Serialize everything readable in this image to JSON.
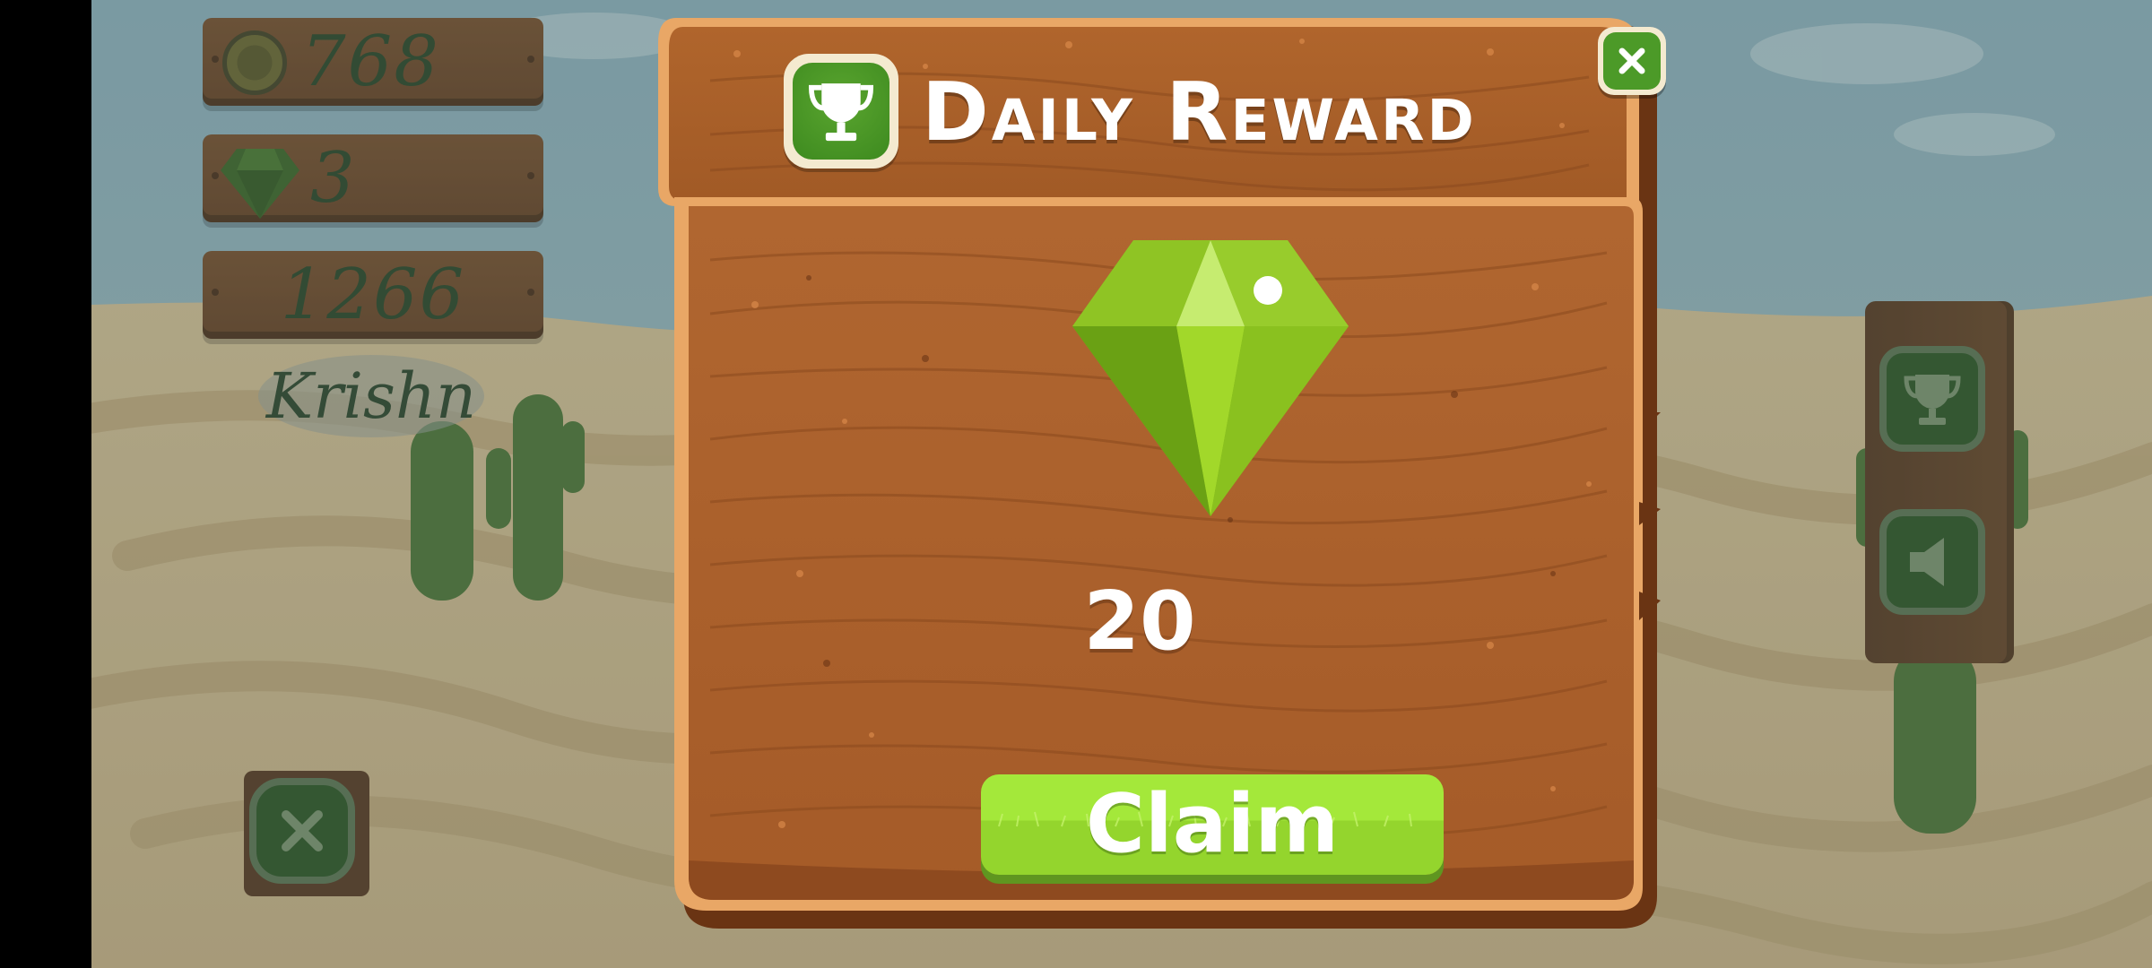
{
  "hud": {
    "coins": "768",
    "gems": "3",
    "score": "1266",
    "player_name": "Krishn"
  },
  "dialog": {
    "title": "Daily Reward",
    "reward_amount": "20",
    "claim_label": "Claim"
  },
  "icons": {
    "coin": "coin-icon",
    "gem": "gem-icon",
    "trophy": "trophy-icon",
    "close": "close-icon",
    "sound": "speaker-icon"
  },
  "colors": {
    "wood": "#a45a2a",
    "wood_dark": "#6d3616",
    "gem_green": "#8fc21a",
    "button_green": "#a4e83a",
    "badge_green": "#4c9a28"
  }
}
